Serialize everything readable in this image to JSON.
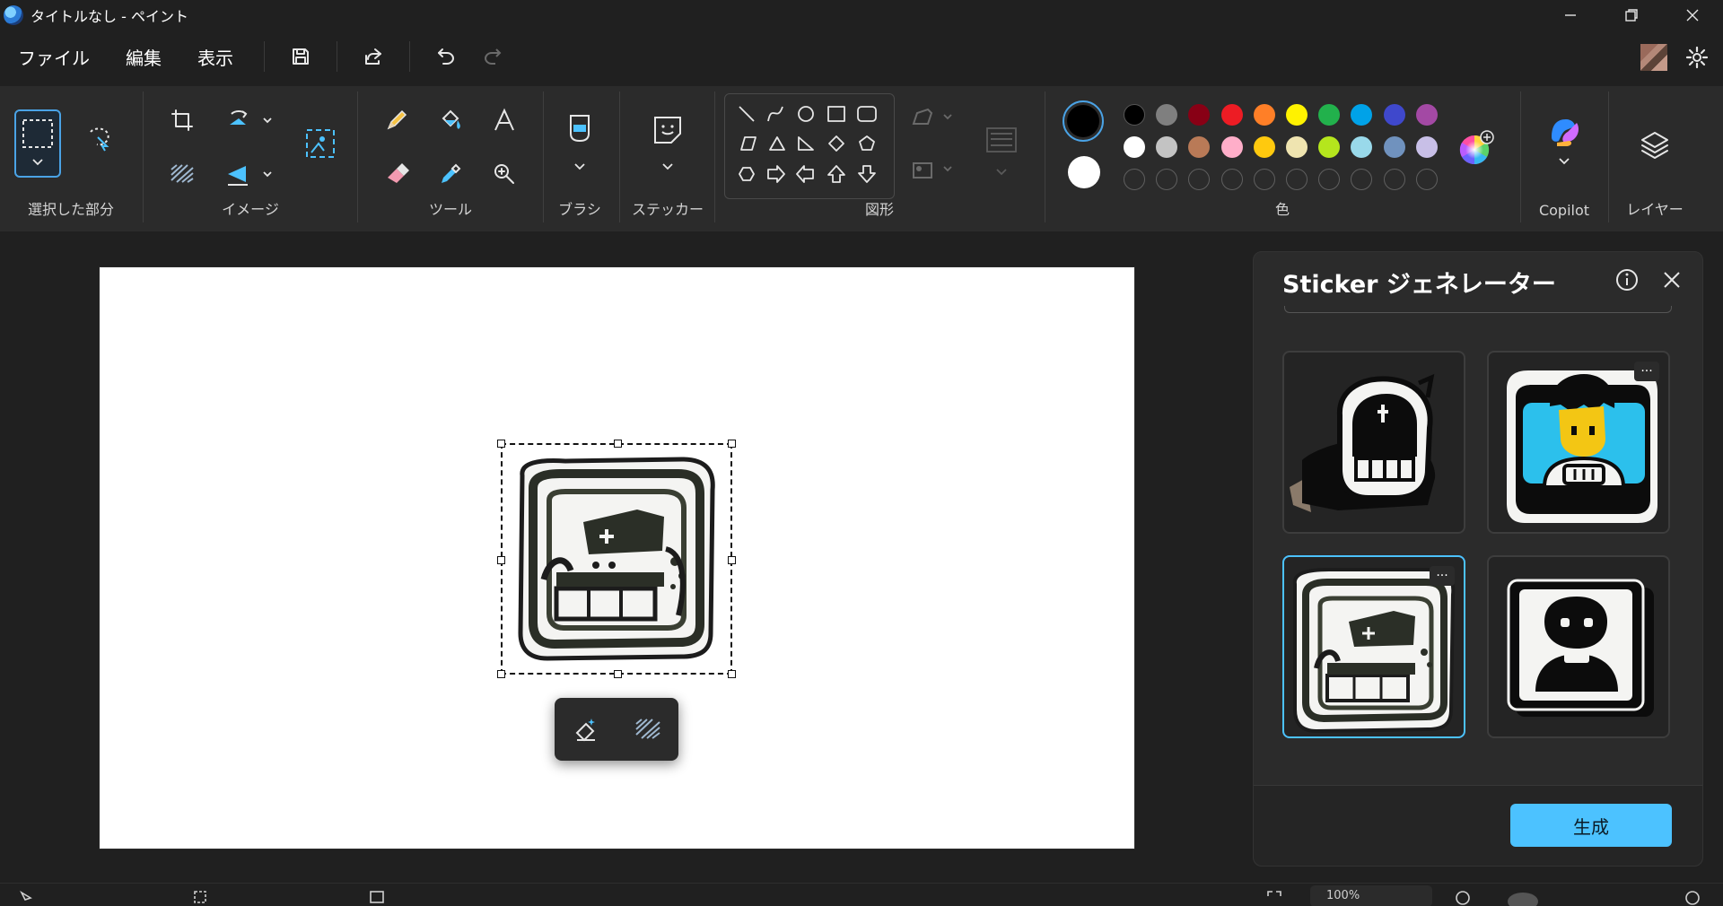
{
  "window": {
    "title": "タイトルなし - ペイント"
  },
  "menu": {
    "file": "ファイル",
    "edit": "編集",
    "view": "表示"
  },
  "ribbon": {
    "groups": {
      "selection": "選択した部分",
      "image": "イメージ",
      "tools": "ツール",
      "brush": "ブラシ",
      "sticker": "ステッカー",
      "shapes": "図形",
      "colors": "色",
      "copilot": "Copilot",
      "layers": "レイヤー"
    },
    "primary_color": "#000000",
    "secondary_color": "#ffffff",
    "palette": [
      [
        "#000000",
        "#7f7f7f",
        "#880015",
        "#ed1c24",
        "#ff7f27",
        "#fff200",
        "#22b14c",
        "#00a2e8",
        "#3f48cc",
        "#a349a4"
      ],
      [
        "#ffffff",
        "#c3c3c3",
        "#b97a57",
        "#ffaec9",
        "#ffc90e",
        "#efe4b0",
        "#b5e61d",
        "#99d9ea",
        "#7092be",
        "#c8bfe7"
      ]
    ]
  },
  "sticker_panel": {
    "title": "Sticker ジェネレーター",
    "stickers": [
      {
        "name": "knight-helmet-sticker",
        "selected": false
      },
      {
        "name": "gamer-boy-sticker",
        "selected": false
      },
      {
        "name": "game-console-sticker",
        "selected": true
      },
      {
        "name": "robot-portrait-sticker",
        "selected": false
      }
    ],
    "more_label": "···",
    "generate_label": "生成"
  },
  "status": {
    "zoom_text": "100%"
  }
}
